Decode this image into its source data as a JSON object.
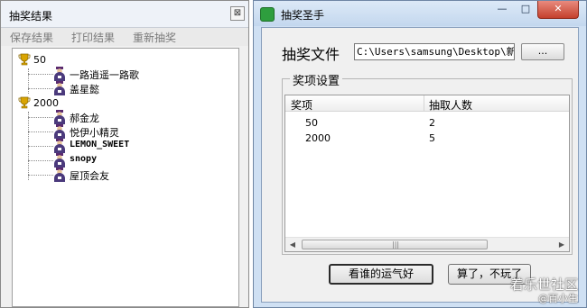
{
  "left_window": {
    "title": "抽奖结果",
    "close_glyph": "⊠",
    "menu": [
      "保存结果",
      "打印结果",
      "重新抽奖"
    ],
    "tree": [
      {
        "prize": "50",
        "winners": [
          "一路逍遥一路歌",
          "盖星懿"
        ]
      },
      {
        "prize": "2000",
        "winners": [
          "郝金龙",
          "悦伊小精灵",
          "LEMON_SWEET",
          "snopy",
          "屋顶会友"
        ]
      }
    ],
    "icons": {
      "prize": "trophy-icon",
      "winner": "person-icon"
    }
  },
  "right_window": {
    "title": "抽奖圣手",
    "controls": {
      "minimize": "—",
      "maximize": "□",
      "close": "✕"
    },
    "file_label": "抽奖文件",
    "file_path": "C:\\Users\\samsung\\Desktop\\新建",
    "browse_label": "...",
    "group_title": "奖项设置",
    "columns": [
      "奖项",
      "抽取人数"
    ],
    "rows": [
      [
        "50",
        "2"
      ],
      [
        "2000",
        "5"
      ]
    ],
    "scroll_left": "◀",
    "scroll_right": "▶",
    "scroll_grip": "|||",
    "lucky_button": "看谁的运气好",
    "quit_button": "算了，不玩了"
  },
  "watermark": {
    "line1": "着乐世社区",
    "line2": "@百小生"
  },
  "colors": {
    "close_button": "#c4402d",
    "app_icon": "#2e9e3e",
    "trophy": "#d9a400"
  }
}
